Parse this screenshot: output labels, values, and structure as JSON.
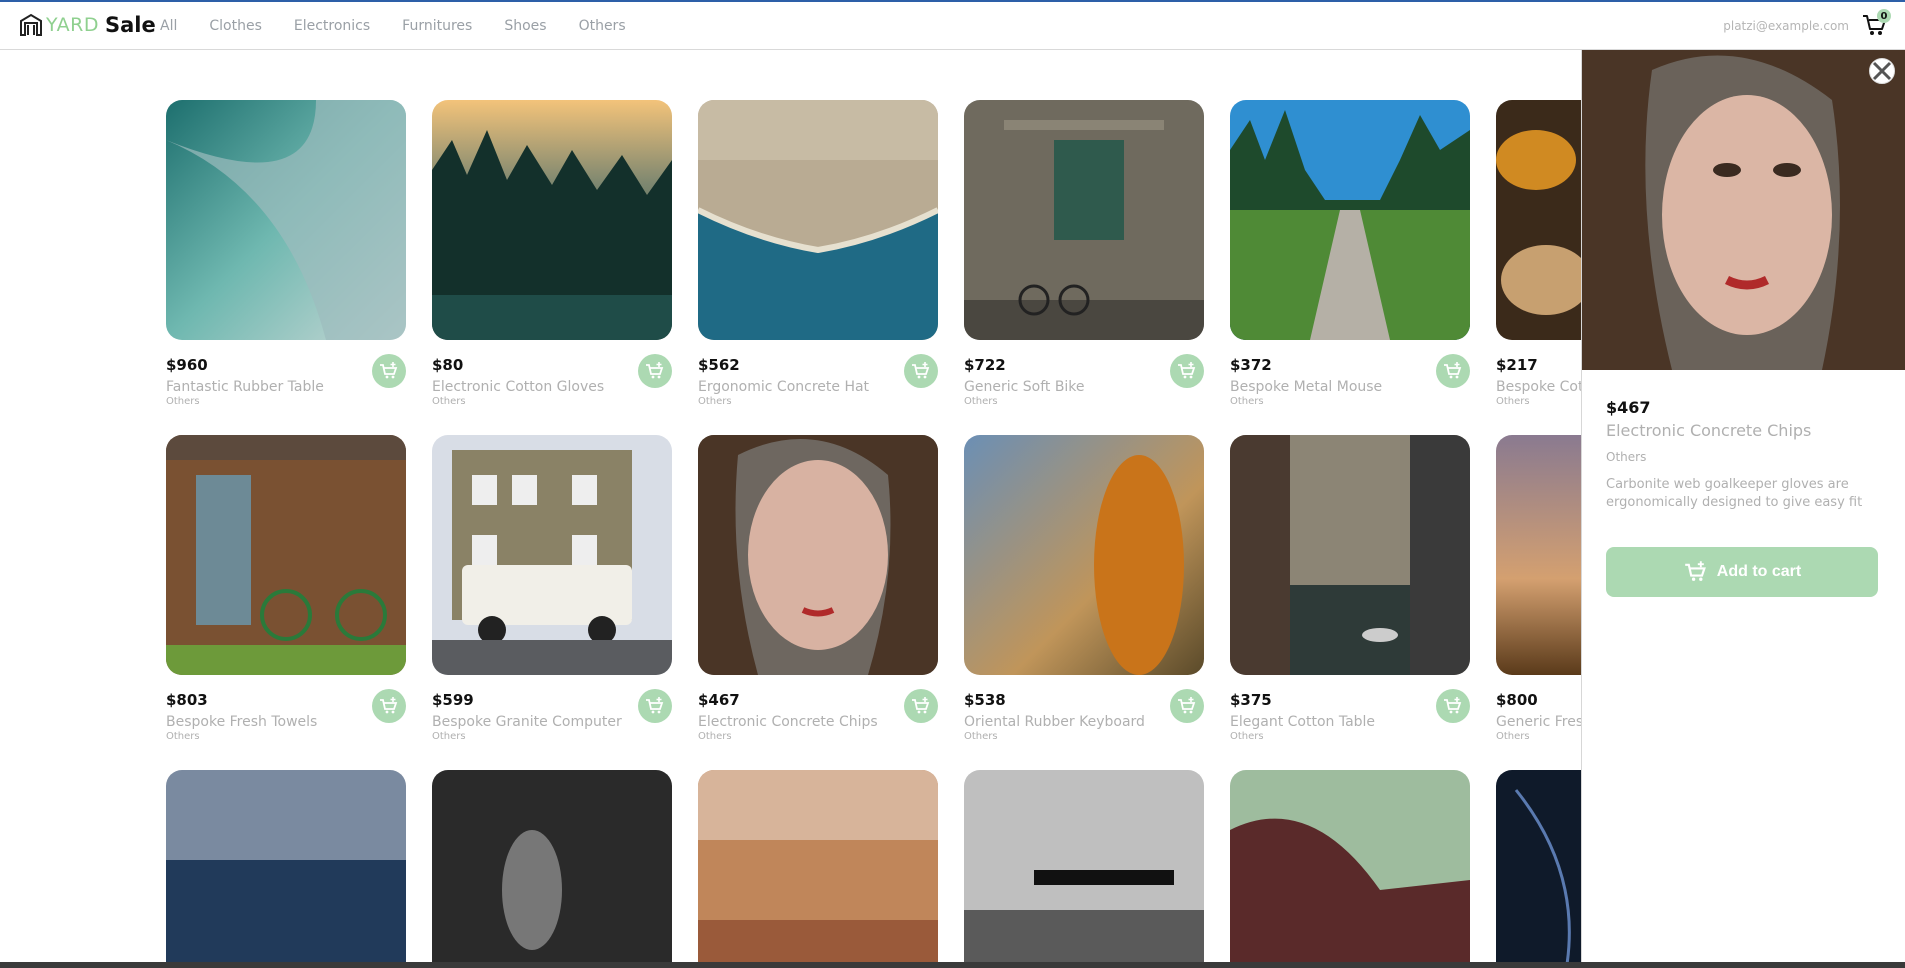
{
  "header": {
    "logo_yard": "YARD",
    "logo_sale": "Sale",
    "nav": [
      "All",
      "Clothes",
      "Electronics",
      "Furnitures",
      "Shoes",
      "Others"
    ],
    "email": "platzi@example.com",
    "cart_count": "0"
  },
  "products": [
    {
      "price": "$960",
      "name": "Fantastic Rubber Table",
      "category": "Others"
    },
    {
      "price": "$80",
      "name": "Electronic Cotton Gloves",
      "category": "Others"
    },
    {
      "price": "$562",
      "name": "Ergonomic Concrete Hat",
      "category": "Others"
    },
    {
      "price": "$722",
      "name": "Generic Soft Bike",
      "category": "Others"
    },
    {
      "price": "$372",
      "name": "Bespoke Metal Mouse",
      "category": "Others"
    },
    {
      "price": "$217",
      "name": "Bespoke Cotton",
      "category": "Others"
    },
    {
      "price": "$803",
      "name": "Bespoke Fresh Towels",
      "category": "Others"
    },
    {
      "price": "$599",
      "name": "Bespoke Granite Computer",
      "category": "Others"
    },
    {
      "price": "$467",
      "name": "Electronic Concrete Chips",
      "category": "Others"
    },
    {
      "price": "$538",
      "name": "Oriental Rubber Keyboard",
      "category": "Others"
    },
    {
      "price": "$375",
      "name": "Elegant Cotton Table",
      "category": "Others"
    },
    {
      "price": "$800",
      "name": "Generic Fresh",
      "category": "Others"
    },
    {
      "price": "",
      "name": "",
      "category": ""
    },
    {
      "price": "",
      "name": "",
      "category": ""
    },
    {
      "price": "",
      "name": "",
      "category": ""
    },
    {
      "price": "",
      "name": "",
      "category": ""
    },
    {
      "price": "",
      "name": "",
      "category": ""
    },
    {
      "price": "",
      "name": "",
      "category": ""
    }
  ],
  "detail": {
    "price": "$467",
    "name": "Electronic Concrete Chips",
    "category": "Others",
    "description": "Carbonite web goalkeeper gloves are ergonomically designed to give easy fit",
    "add_label": "Add to cart"
  },
  "colors": {
    "accent": "#acd9b2",
    "muted_text": "#b0b0b0",
    "top_line": "#2d5fa8"
  }
}
